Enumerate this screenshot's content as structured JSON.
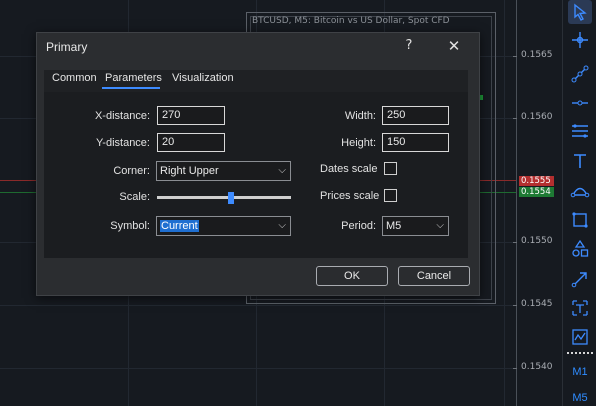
{
  "chart": {
    "subwindow_title": "BTCUSD, M5:  Bitcoin vs US Dollar, Spot CFD",
    "price_labels": [
      "0.1565",
      "0.1560",
      "0.1555",
      "0.1554",
      "0.1550",
      "0.1545",
      "0.1540"
    ],
    "ask_price_badge": "0.1555",
    "bid_price_badge": "0.1554",
    "ask_color": "#b32f2f",
    "bid_color": "#1e7a34"
  },
  "toolbar": {
    "tools": [
      "cursor-icon",
      "crosshair-icon",
      "trendline-icon",
      "horizontal-line-icon",
      "channel-icon",
      "text-icon",
      "fibonacci-icon",
      "rectangle-icon",
      "shapes-icon",
      "arrow-icon",
      "text-label-icon",
      "indicator-icon"
    ],
    "timeframes": [
      "M1",
      "M5"
    ],
    "accent": "#2f8cff"
  },
  "dialog": {
    "title": "Primary",
    "help_label": "?",
    "close_label": "✕",
    "tabs": [
      "Common",
      "Parameters",
      "Visualization"
    ],
    "active_tab": "Parameters",
    "fields": {
      "x_distance_label": "X-distance:",
      "x_distance_value": "270",
      "y_distance_label": "Y-distance:",
      "y_distance_value": "20",
      "width_label": "Width:",
      "width_value": "250",
      "height_label": "Height:",
      "height_value": "150",
      "corner_label": "Corner:",
      "corner_value": "Right Upper",
      "dates_scale_label": "Dates scale",
      "dates_scale_checked": false,
      "scale_label": "Scale:",
      "scale_level": 0.55,
      "prices_scale_label": "Prices scale",
      "prices_scale_checked": false,
      "symbol_label": "Symbol:",
      "symbol_value": "Current",
      "period_label": "Period:",
      "period_value": "M5"
    },
    "ok_label": "OK",
    "cancel_label": "Cancel",
    "accent": "#3d8bff"
  }
}
